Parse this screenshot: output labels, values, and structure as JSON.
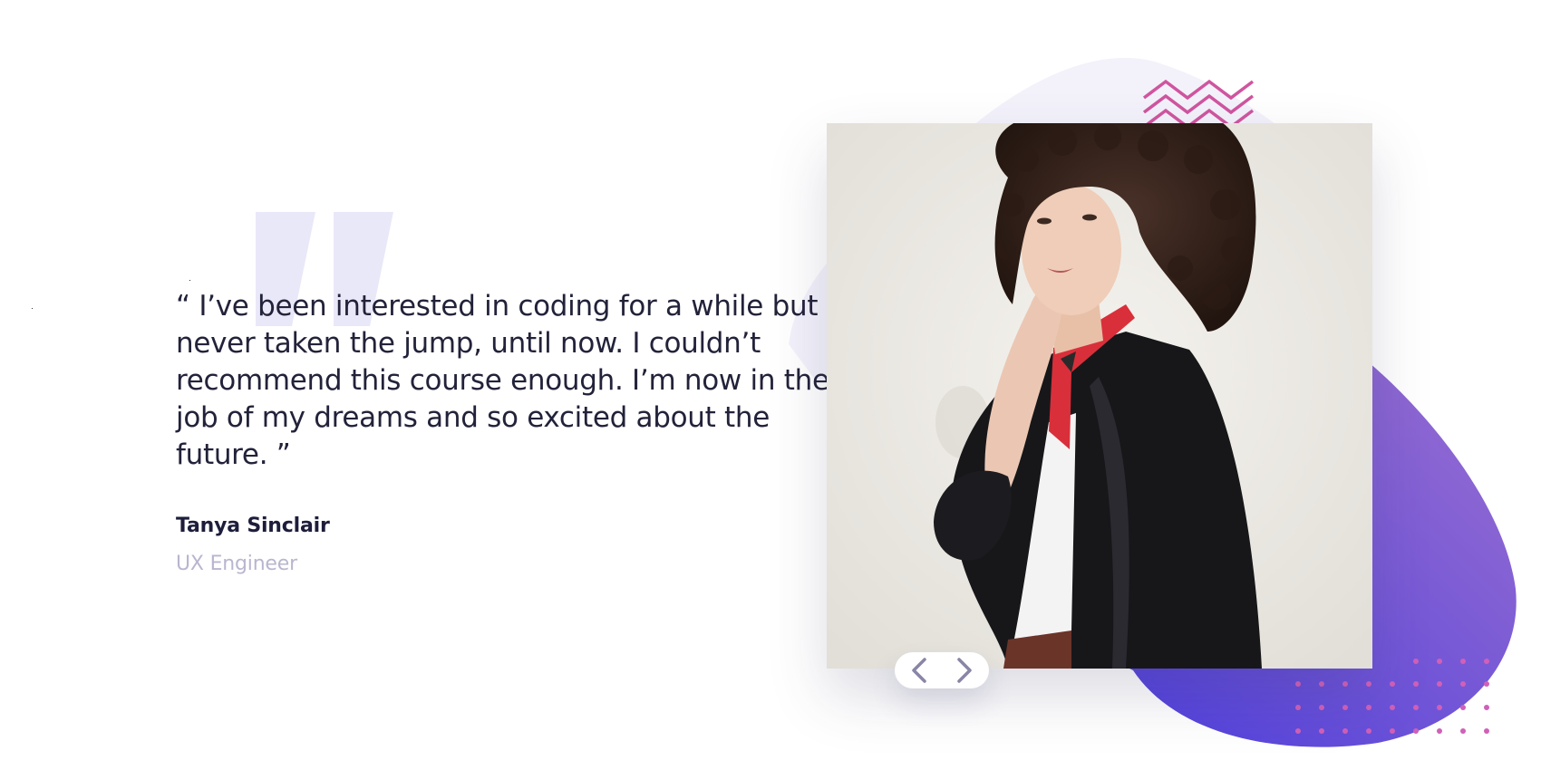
{
  "testimonial": {
    "quote": "“ I’ve been interested in coding for a while but never taken the jump, until now. I couldn’t recommend this course enough. I’m now in the job of my dreams and so excited about the future. ”",
    "author_name": "Tanya Sinclair",
    "author_role": "UX Engineer"
  },
  "photo": {
    "icon": "portrait-photo"
  },
  "slider": {
    "prev_icon": "chevron-left-icon",
    "next_icon": "chevron-right-icon"
  },
  "colors": {
    "quote_text": "#22223a",
    "name_text": "#1d1d3b",
    "role_text": "#b8b6cf",
    "quote_marks": "#e9e8f8",
    "blob_light": "#f3f2fb",
    "blob_gradient_start": "#5b4ad8",
    "blob_gradient_end": "#8f6ad2",
    "pattern_pink": "#d0559f",
    "chevron": "#8885a6"
  }
}
